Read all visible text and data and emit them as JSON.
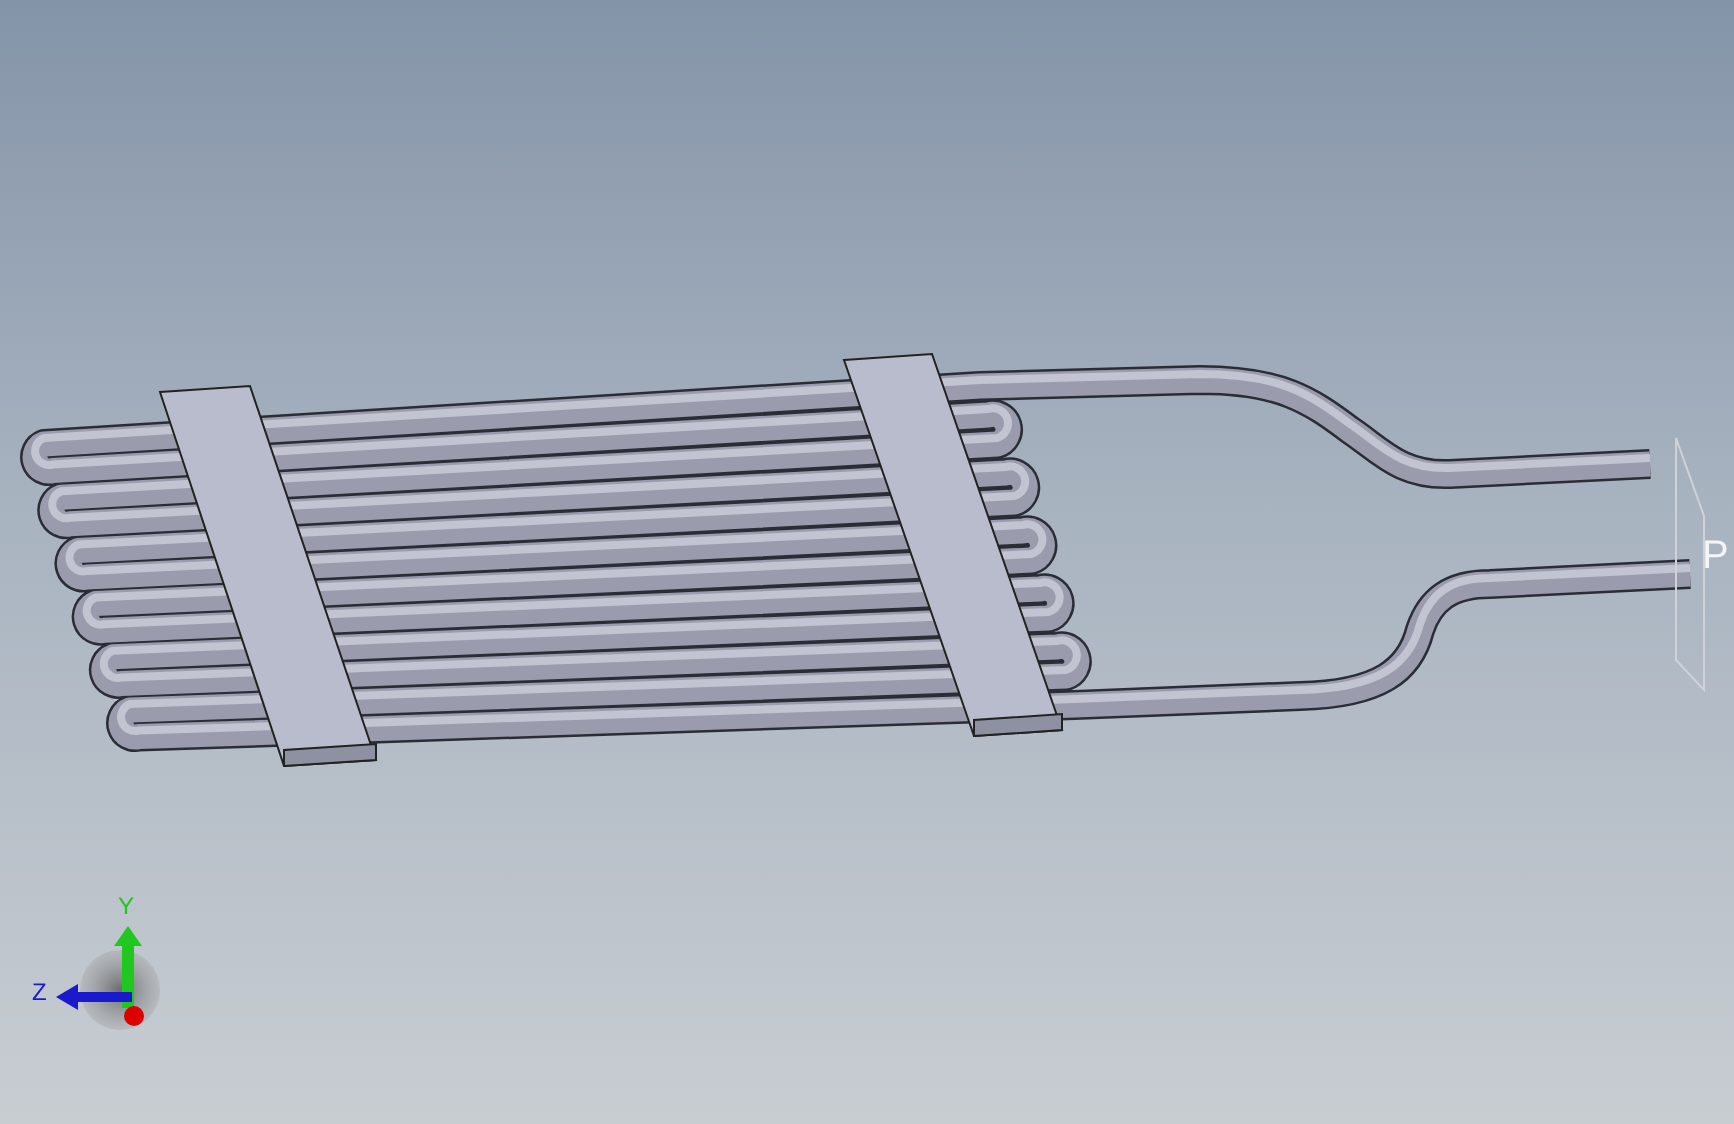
{
  "triad": {
    "axes": [
      {
        "kind": "up",
        "label": "Y",
        "color": "#1ec81e"
      },
      {
        "kind": "left",
        "label": "Z",
        "color": "#1a1acc"
      }
    ]
  },
  "plane": {
    "label": "P"
  }
}
